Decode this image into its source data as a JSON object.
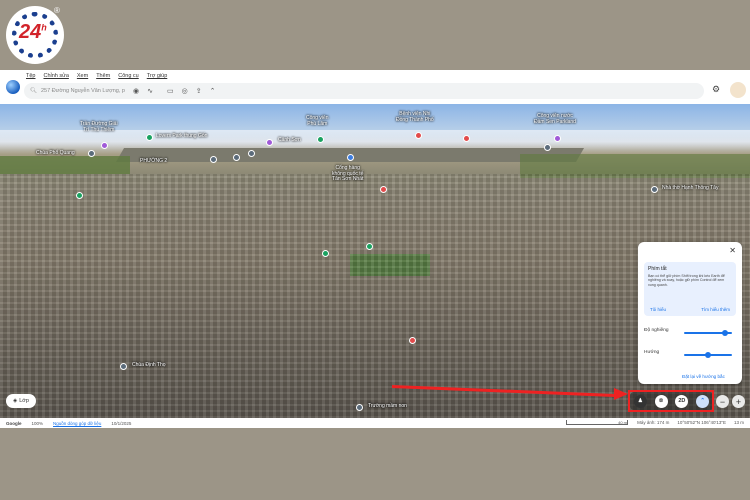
{
  "logo": {
    "text": "24",
    "sup": "h",
    "reg": "®"
  },
  "menu": [
    "Tệp",
    "Chỉnh sửa",
    "Xem",
    "Thêm",
    "Công cụ",
    "Trợ giúp"
  ],
  "search": {
    "placeholder": "257 Đường Nguyễn Văn Lượng, p"
  },
  "map_labels": {
    "l1": "Trần Đường Giải\nTrí Thủ Thiêm",
    "l2": "Lovers Park thung Gốn",
    "l3": "Chùa Phổ Quang",
    "l4": "PHƯỜNG 2",
    "l5": "Cảnh Sơn",
    "l6": "Công viên\nPhú Lâm",
    "l7": "Cổng hàng\nkhông quốc tế\nTân Sơn Nhất",
    "l8": "Bệnh viện Nhi\nĐồng Thành Phố",
    "l9": "Công viên nước\nĐầm Sen Parkland",
    "l10": "Nhà thờ Hạnh Thông Tây",
    "l11": "Chùa Định Thọ",
    "l12": "Trường mầm non"
  },
  "layers_label": "Lớp",
  "status": {
    "brand": "Google",
    "zoom": "100%",
    "source": "Nguồn dòng góp dữ liệu",
    "date": "10/1/2025",
    "scale": "40 m",
    "camera": "Máy ảnh: 174 m",
    "coords": "10°50'52\"N 106°40'13\"E",
    "alt": "13 m"
  },
  "panel": {
    "tip_title": "Phím tắt",
    "tip_body": "Bạn có thể giữ phím Shift trong khi kéo Earth để nghiêng và xoay, hoặc giữ phím Control để xem xung quanh.",
    "dismiss": "Tôi hiểu",
    "learn_more": "Tìm hiểu thêm",
    "tilt_label": "Độ nghiêng",
    "tilt_value": 0.9,
    "heading_label": "Hướng",
    "heading_value": 0.5,
    "reset": "Đặt lại về hướng bắc"
  },
  "controls": {
    "view_2d": "2D"
  }
}
